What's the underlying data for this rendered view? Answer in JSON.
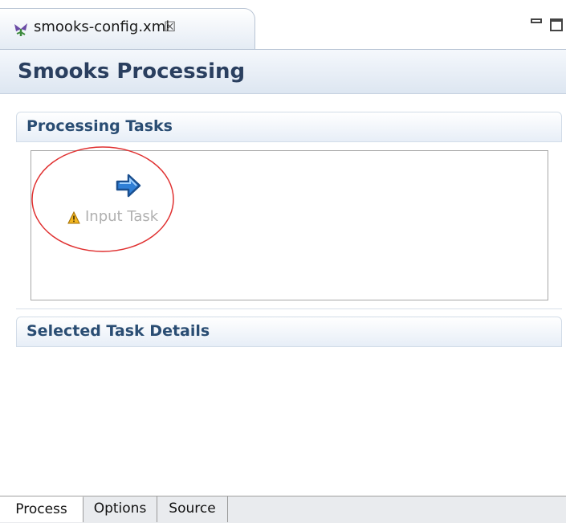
{
  "editor_tab": {
    "title": "smooks-config.xml",
    "close_glyph": "☒"
  },
  "page": {
    "title": "Smooks Processing"
  },
  "sections": {
    "processing_tasks": "Processing Tasks",
    "selected_task_details": "Selected Task Details"
  },
  "task": {
    "label": "Input Task",
    "icon": "arrow-right-icon",
    "status_icon": "warning-icon"
  },
  "annotation": {
    "shape": "ellipse",
    "color": "#e03030"
  },
  "bottom_tabs": [
    {
      "label": "Process",
      "active": true
    },
    {
      "label": "Options",
      "active": false
    },
    {
      "label": "Source",
      "active": false
    }
  ],
  "colors": {
    "header_text": "#2a3f5f",
    "section_text": "#2a4d73",
    "arrow_fill": "#3c8ad8"
  }
}
